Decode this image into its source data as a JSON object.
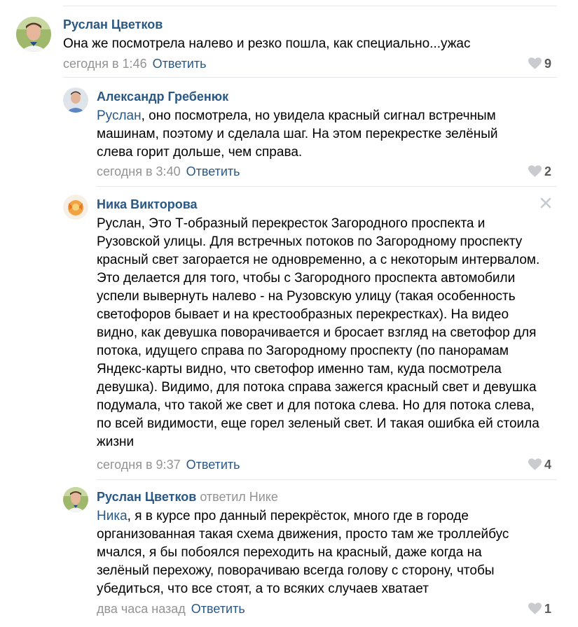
{
  "comments": [
    {
      "author": "Руслан Цветков",
      "replied_to": "",
      "mention": "",
      "text": "Она же посмотрела налево и резко пошла, как специально...ужас",
      "time": "сегодня в 1:46",
      "reply_label": "Ответить",
      "likes": "9"
    },
    {
      "author": "Александр Гребенюк",
      "replied_to": "",
      "mention": "Руслан",
      "text": ", оно посмотрела, но увидела красный сигнал встречным машинам, поэтому и сделала шаг. На этом перекрестке зелёный слева горит дольше, чем справа.",
      "time": "сегодня в 3:40",
      "reply_label": "Ответить",
      "likes": "2"
    },
    {
      "author": "Ника Викторова",
      "replied_to": "",
      "mention": "",
      "text": "Руслан, Это Т-образный перекресток Загородного проспекта и Рузовской улицы. Для встречных потоков по Загородному проспекту красный свет загорается не одновременно, а с некоторым интервалом. Это делается для того, чтобы с Загородного проспекта автомобили успели вывернуть налево - на Рузовскую улицу (такая особенность светофоров бывает и на крестообразных перекрестках). На видео видно, как девушка поворачивается и бросает взгляд на светофор для потока, идущего справа по Загородному проспекту (по панорамам Яндекс-карты видно, что светофор именно там, куда посмотрела девушка). Видимо, для потока справа зажегся красный свет и девушка подумала, что такой же свет и для потока слева. Но для потока слева, по всей видимости, еще горел зеленый свет. И такая ошибка ей стоила жизни",
      "time": "сегодня в 9:37",
      "reply_label": "Ответить",
      "likes": "4"
    },
    {
      "author": "Руслан Цветков",
      "replied_to": "ответил Нике",
      "mention": "Ника",
      "text": ", я в курсе про данный перекрёсток, много где в городе организованная такая схема движения, просто там же троллейбус мчался, я бы побоялся переходить на красный, даже когда на зелёный перехожу, поворачиваю всегда голову с сторону, чтобы убедиться, что все стоят, а то всяких случаев хватает",
      "time": "два часа назад",
      "reply_label": "Ответить",
      "likes": "1"
    }
  ],
  "colors": {
    "link": "#2a5885",
    "meta": "#939393",
    "heart": "#c9cbcf",
    "divider": "#e7e8ec"
  },
  "icons": {
    "like": "heart-icon",
    "delete": "close-icon"
  }
}
